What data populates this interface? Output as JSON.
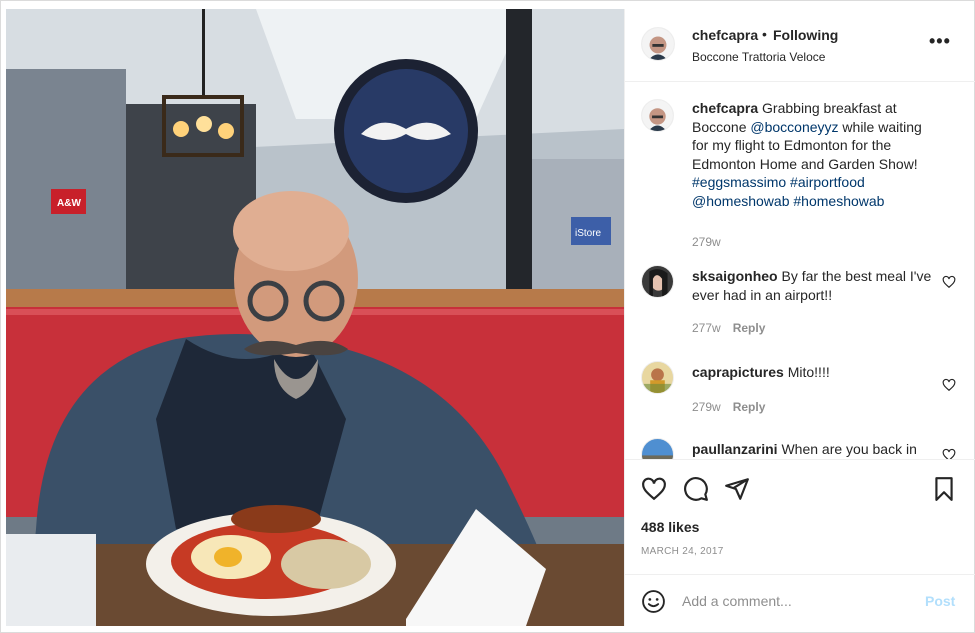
{
  "post": {
    "username": "chefcapra",
    "dot": "•",
    "follow_label": "Following",
    "location": "Boccone Trattoria Veloce",
    "more_label": "•••",
    "likes": "488 likes",
    "date": "MARCH 24, 2017"
  },
  "caption": {
    "username": "chefcapra",
    "text_1": "Grabbing breakfast at Boccone ",
    "mention_1": "@bocconeyyz",
    "text_2": " while waiting for my flight to Edmonton for the Edmonton Home and Garden Show! ",
    "tag_1": "#eggsmassimo",
    "tag_2": "#airportfood",
    "mention_2": "@homeshowab",
    "tag_3": "#homeshowab",
    "age": "279w"
  },
  "comments": [
    {
      "username": "sksaigonheo",
      "text": "By far the best meal I've ever had in an airport!!",
      "age": "277w",
      "reply": "Reply"
    },
    {
      "username": "caprapictures",
      "text": "Mito!!!!",
      "age": "279w",
      "reply": "Reply"
    },
    {
      "username": "paullanzarini",
      "text": "When are you back in",
      "age": "",
      "reply": ""
    }
  ],
  "add_comment": {
    "placeholder": "Add a comment...",
    "post_label": "Post"
  },
  "photo": {
    "sign_text": "A&W",
    "store_text": "iStore"
  },
  "colors": {
    "link": "#00376b",
    "secondary": "#8e8e8e",
    "post_disabled": "#b2dffc",
    "booth_red": "#c8303a"
  },
  "icons": [
    "more-icon",
    "heart-icon",
    "comment-icon",
    "share-icon",
    "bookmark-icon",
    "emoji-icon"
  ]
}
